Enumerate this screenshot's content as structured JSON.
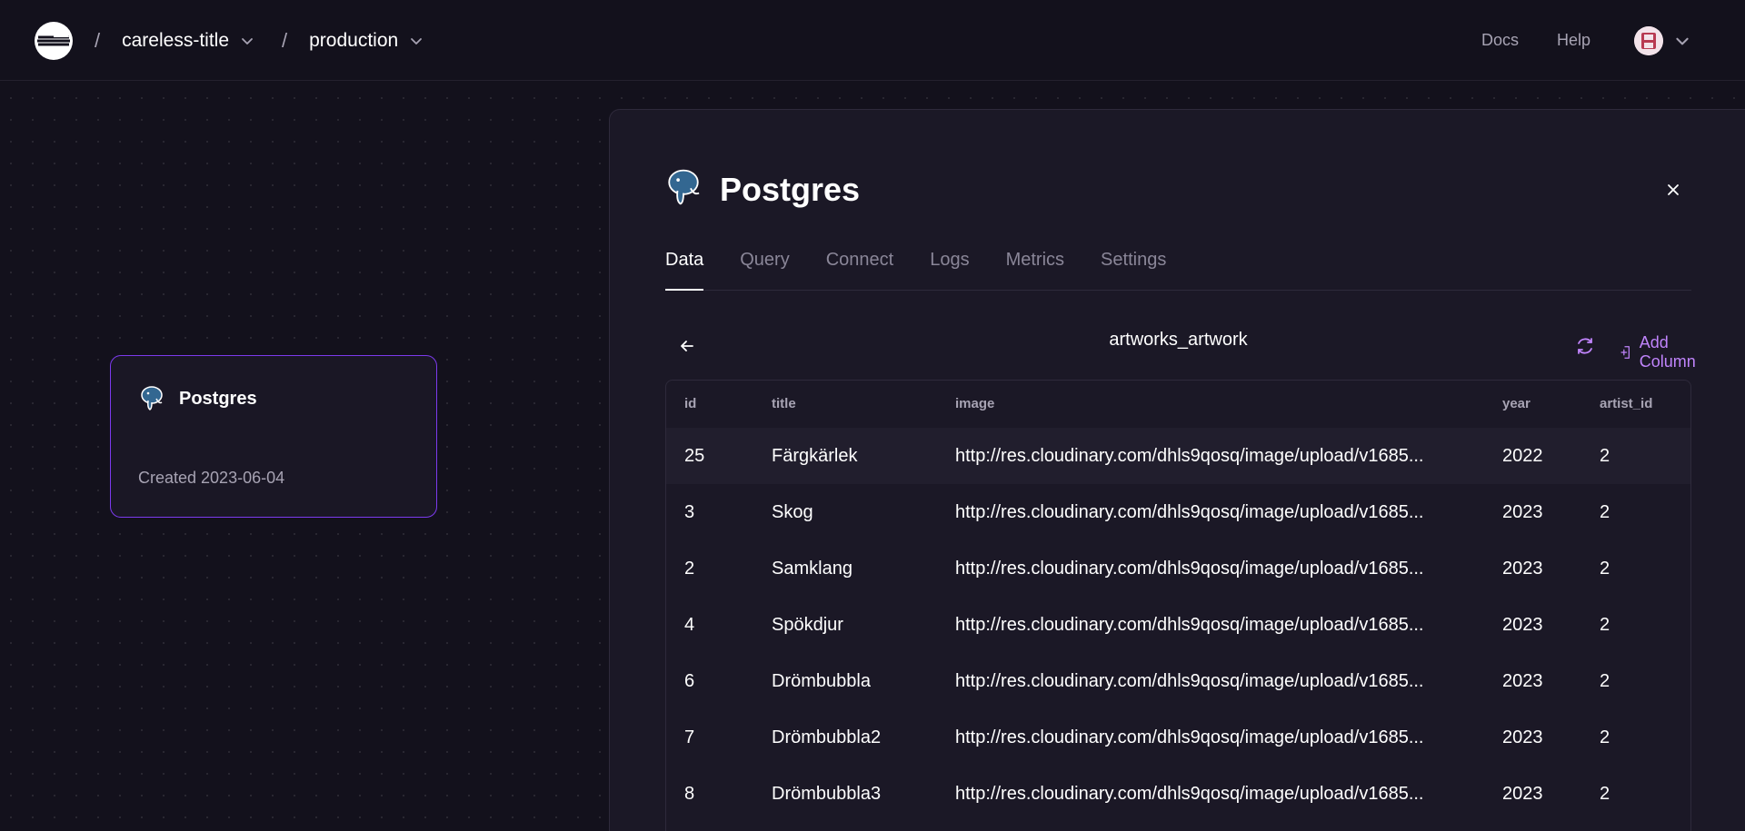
{
  "topbar": {
    "project": "careless-title",
    "environment": "production",
    "separator": "/",
    "nav": {
      "docs": "Docs",
      "help": "Help"
    }
  },
  "canvas": {
    "service_card": {
      "name": "Postgres",
      "created": "Created 2023-06-04"
    }
  },
  "panel": {
    "title": "Postgres",
    "tabs": [
      {
        "label": "Data",
        "active": true
      },
      {
        "label": "Query"
      },
      {
        "label": "Connect"
      },
      {
        "label": "Logs"
      },
      {
        "label": "Metrics"
      },
      {
        "label": "Settings"
      }
    ],
    "table_name": "artworks_artwork",
    "add_column_label": "Add Column",
    "columns": [
      "id",
      "title",
      "image",
      "year",
      "artist_id"
    ],
    "rows": [
      {
        "id": "25",
        "title": "Färgkärlek",
        "image": "http://res.cloudinary.com/dhls9qosq/image/upload/v1685...",
        "year": "2022",
        "artist_id": "2"
      },
      {
        "id": "3",
        "title": "Skog",
        "image": "http://res.cloudinary.com/dhls9qosq/image/upload/v1685...",
        "year": "2023",
        "artist_id": "2"
      },
      {
        "id": "2",
        "title": "Samklang",
        "image": "http://res.cloudinary.com/dhls9qosq/image/upload/v1685...",
        "year": "2023",
        "artist_id": "2"
      },
      {
        "id": "4",
        "title": "Spökdjur",
        "image": "http://res.cloudinary.com/dhls9qosq/image/upload/v1685...",
        "year": "2023",
        "artist_id": "2"
      },
      {
        "id": "6",
        "title": "Drömbubbla",
        "image": "http://res.cloudinary.com/dhls9qosq/image/upload/v1685...",
        "year": "2023",
        "artist_id": "2"
      },
      {
        "id": "7",
        "title": "Drömbubbla2",
        "image": "http://res.cloudinary.com/dhls9qosq/image/upload/v1685...",
        "year": "2023",
        "artist_id": "2"
      },
      {
        "id": "8",
        "title": "Drömbubbla3",
        "image": "http://res.cloudinary.com/dhls9qosq/image/upload/v1685...",
        "year": "2023",
        "artist_id": "2"
      }
    ]
  },
  "icons": {
    "logo": "railway-logo-icon",
    "database": "postgres-elephant-icon",
    "close": "close-icon",
    "back": "arrow-left-icon",
    "refresh": "refresh-icon",
    "add_column": "add-column-icon",
    "chevron": "chevron-down-icon"
  },
  "colors": {
    "background": "#13111c",
    "panel": "#1b1826",
    "accent": "#c084fc",
    "card_border": "#7c3aed",
    "muted_text": "#a7a3b3"
  }
}
